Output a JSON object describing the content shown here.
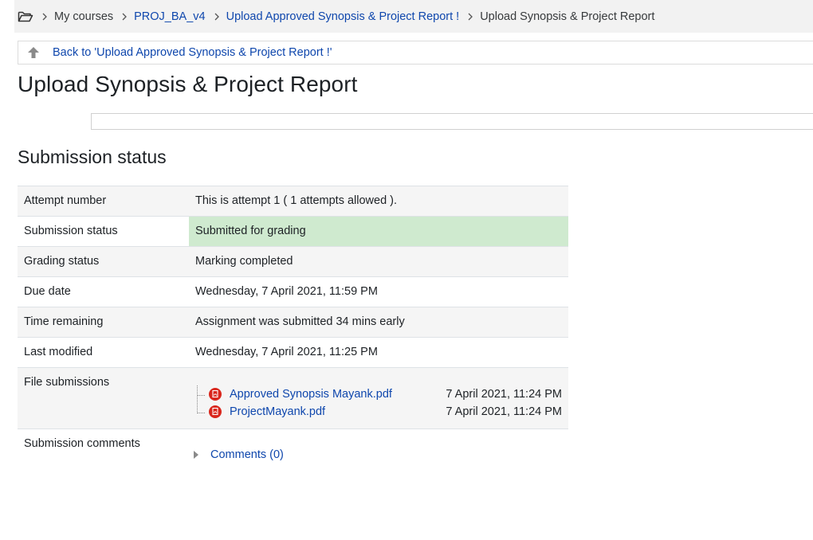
{
  "breadcrumb": {
    "items": [
      {
        "label": "My courses",
        "link": false
      },
      {
        "label": "PROJ_BA_v4",
        "link": true
      },
      {
        "label": "Upload Approved Synopsis & Project Report !",
        "link": true
      },
      {
        "label": "Upload Synopsis & Project Report",
        "link": false
      }
    ]
  },
  "back_link": "Back to 'Upload Approved Synopsis & Project Report !'",
  "page_title": "Upload Synopsis & Project Report",
  "section_title": "Submission status",
  "rows": {
    "attempt": {
      "label": "Attempt number",
      "value": "This is attempt 1 ( 1 attempts allowed )."
    },
    "submission": {
      "label": "Submission status",
      "value": "Submitted for grading"
    },
    "grading": {
      "label": "Grading status",
      "value": "Marking completed"
    },
    "due": {
      "label": "Due date",
      "value": "Wednesday, 7 April 2021, 11:59 PM"
    },
    "remaining": {
      "label": "Time remaining",
      "value": "Assignment was submitted 34 mins early"
    },
    "modified": {
      "label": "Last modified",
      "value": "Wednesday, 7 April 2021, 11:25 PM"
    },
    "files": {
      "label": "File submissions",
      "items": [
        {
          "name": "Approved Synopsis Mayank.pdf",
          "date": "7 April 2021, 11:24 PM"
        },
        {
          "name": "ProjectMayank.pdf",
          "date": "7 April 2021, 11:24 PM"
        }
      ]
    },
    "comments": {
      "label": "Submission comments",
      "link": "Comments (0)"
    }
  },
  "colors": {
    "link": "#0f47ad",
    "submitted_bg": "#cfeacf",
    "pdf_icon": "#d9261c"
  },
  "icons": [
    "folder-icon",
    "chevron-right-icon",
    "arrow-up-icon",
    "pdf-icon",
    "caret-right-icon"
  ]
}
